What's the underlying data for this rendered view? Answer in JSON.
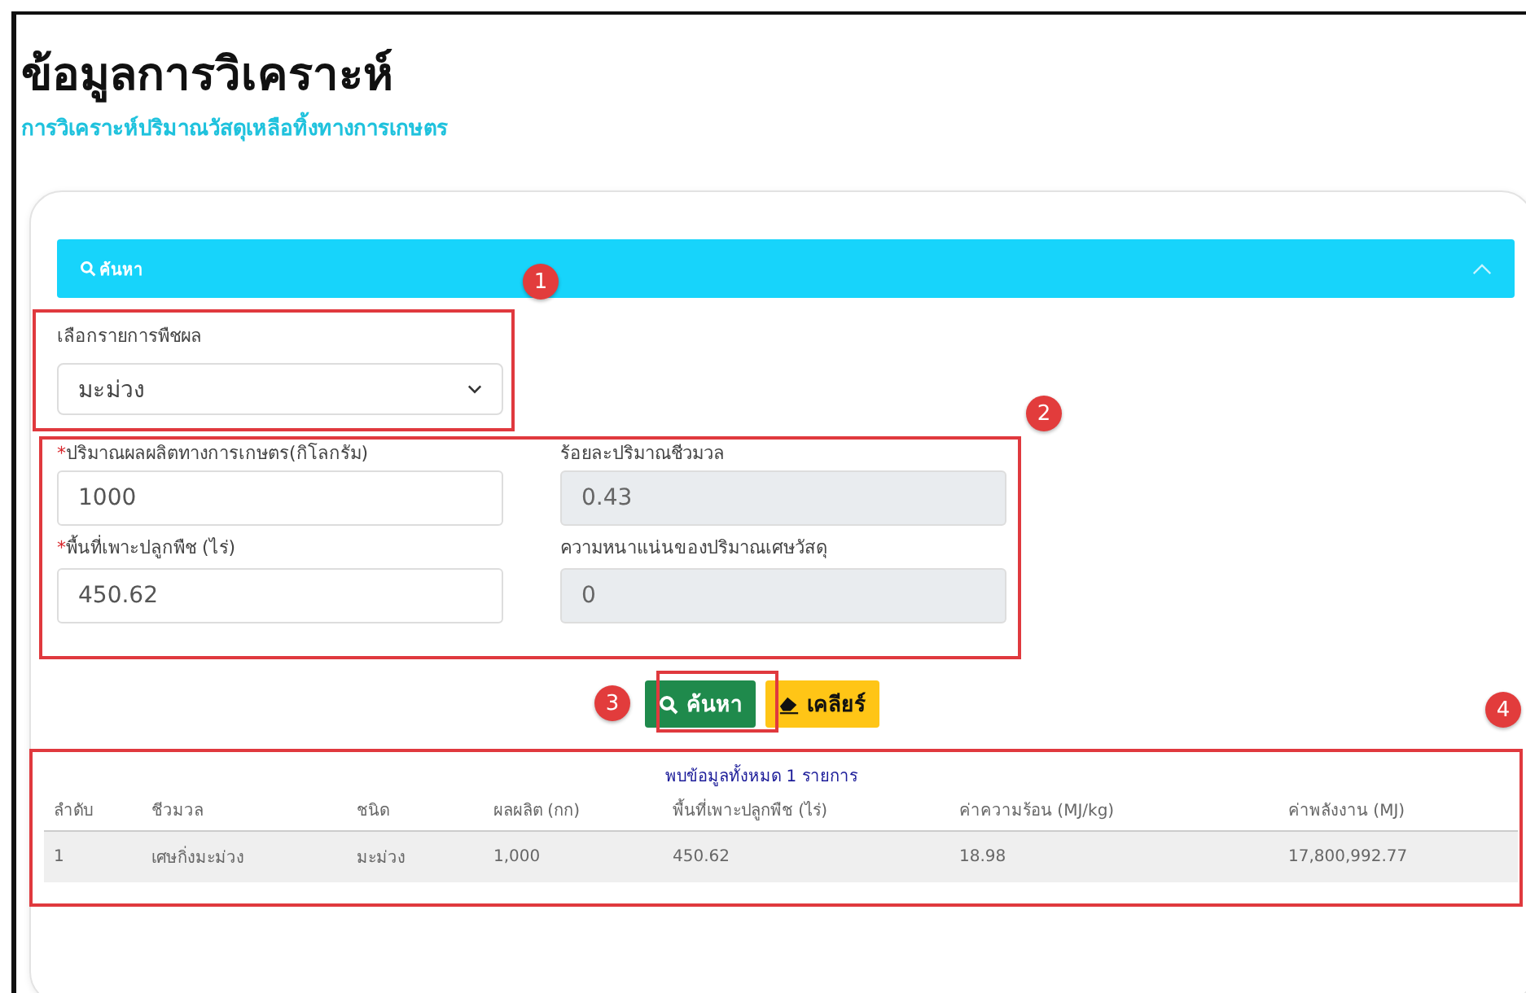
{
  "page": {
    "title": "ข้อมูลการวิเคราะห์",
    "subtitle": "การวิเคราะห์ปริมาณวัสดุเหลือทิ้งทางการเกษตร"
  },
  "panel": {
    "title": "ค้นหา",
    "expanded": true
  },
  "crop_select": {
    "label": "เลือกรายการพืชผล",
    "value": "มะม่วง"
  },
  "fields": [
    {
      "marker": "*",
      "label": "ปริมาณผลผลิตทางการเกษตร(กิโลกรัม)",
      "value": "1000",
      "kind": "input"
    },
    {
      "label": "ร้อยละปริมาณชีวมวล",
      "value": "0.43",
      "kind": "readonly"
    },
    {
      "marker": "*",
      "label": "พื้นที่เพาะปลูกพืช (ไร่)",
      "value": "450.62",
      "kind": "input"
    },
    {
      "label": "ความหนาแน่นของปริมาณเศษวัสดุ",
      "value": "0",
      "kind": "readonly"
    }
  ],
  "buttons": [
    {
      "label": "ค้นหา",
      "kind": "search"
    },
    {
      "label": "เคลียร์",
      "kind": "clear"
    }
  ],
  "table": {
    "summary": "พบข้อมูลทั้งหมด 1 รายการ",
    "columns": [
      "ลำดับ",
      "ชีวมวล",
      "ชนิด",
      "ผลผลิต (กก)",
      "พื้นที่เพาะปลูกพืช (ไร่)",
      "ค่าความร้อน (MJ/kg)",
      "ค่าพลังงาน (MJ)"
    ],
    "rows": [
      [
        "1",
        "เศษกิ่งมะม่วง",
        "มะม่วง",
        "1,000",
        "450.62",
        "18.98",
        "17,800,992.77"
      ]
    ]
  },
  "annotations": [
    "1",
    "2",
    "3",
    "4"
  ]
}
